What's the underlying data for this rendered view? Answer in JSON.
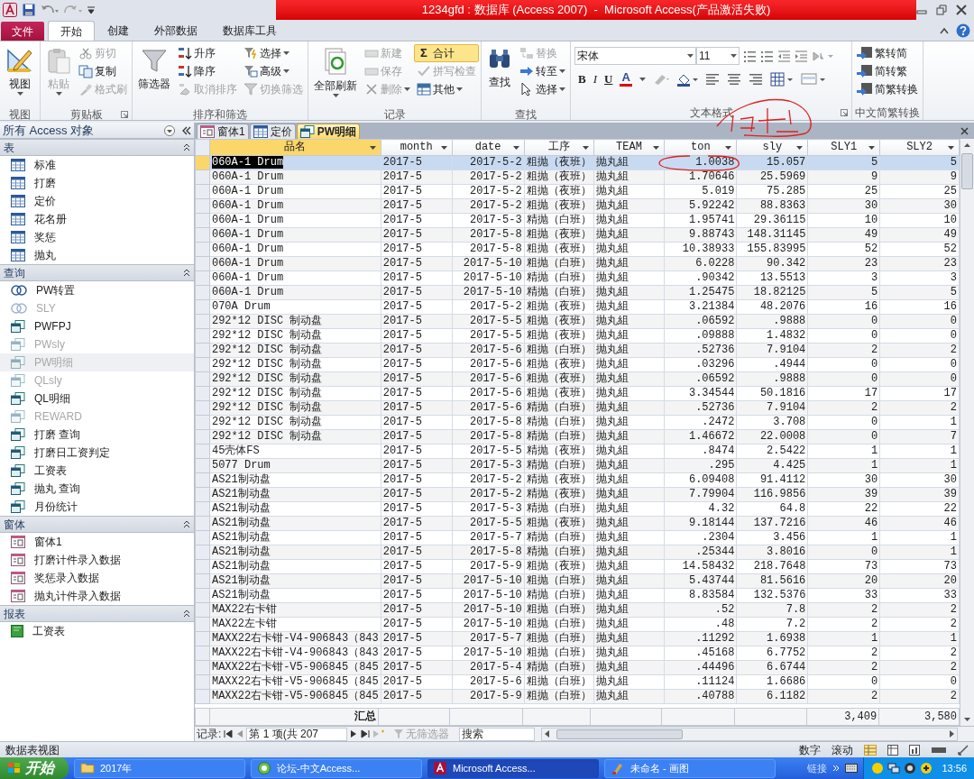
{
  "title_bar": {
    "title": "1234gfd : 数据库 (Access 2007)  -  Microsoft Access(产品激活失败)"
  },
  "ribbon_tabs": [
    {
      "label": "文件",
      "kind": "file",
      "selected": false
    },
    {
      "label": "开始",
      "kind": "tab",
      "selected": true
    },
    {
      "label": "创建",
      "kind": "tab",
      "selected": false
    },
    {
      "label": "外部数据",
      "kind": "tab",
      "selected": false
    },
    {
      "label": "数据库工具",
      "kind": "tab",
      "selected": false
    }
  ],
  "ribbon_groups": [
    {
      "label": "视图",
      "kind": "buttons",
      "launcher": false,
      "items": [
        {
          "label": "视图",
          "disabled": false,
          "dropdown": true,
          "pressed": false
        }
      ]
    },
    {
      "label": "剪贴板",
      "kind": "buttons",
      "launcher": true,
      "items": [
        {
          "label": "粘贴",
          "disabled": true,
          "dropdown": true,
          "pressed": false
        },
        {
          "label": "剪切",
          "disabled": true,
          "dropdown": false,
          "pressed": false
        },
        {
          "label": "复制",
          "disabled": false,
          "dropdown": false,
          "pressed": false
        },
        {
          "label": "格式刷",
          "disabled": true,
          "dropdown": false,
          "pressed": false
        }
      ]
    },
    {
      "label": "排序和筛选",
      "kind": "buttons",
      "launcher": false,
      "items": [
        {
          "label": "筛选器",
          "disabled": false,
          "dropdown": false,
          "pressed": false
        },
        {
          "label": "升序",
          "disabled": false,
          "dropdown": false,
          "pressed": false
        },
        {
          "label": "降序",
          "disabled": false,
          "dropdown": false,
          "pressed": false
        },
        {
          "label": "取消排序",
          "disabled": true,
          "dropdown": false,
          "pressed": false
        },
        {
          "label": "选择",
          "disabled": false,
          "dropdown": true,
          "pressed": false
        },
        {
          "label": "高级",
          "disabled": false,
          "dropdown": true,
          "pressed": false
        },
        {
          "label": "切换筛选",
          "disabled": true,
          "dropdown": false,
          "pressed": false
        }
      ]
    },
    {
      "label": "记录",
      "kind": "buttons",
      "launcher": false,
      "items": [
        {
          "label": "全部刷新",
          "disabled": false,
          "dropdown": true,
          "pressed": false
        },
        {
          "label": "新建",
          "disabled": true,
          "dropdown": false,
          "pressed": false
        },
        {
          "label": "保存",
          "disabled": true,
          "dropdown": false,
          "pressed": false
        },
        {
          "label": "删除",
          "disabled": true,
          "dropdown": true,
          "pressed": false
        },
        {
          "label": "合计",
          "symbol": "Σ",
          "disabled": false,
          "dropdown": false,
          "pressed": true
        },
        {
          "label": "拼写检查",
          "disabled": true,
          "dropdown": false,
          "pressed": false
        },
        {
          "label": "其他",
          "disabled": false,
          "dropdown": true,
          "pressed": false
        }
      ]
    },
    {
      "label": "查找",
      "kind": "buttons",
      "launcher": false,
      "items": [
        {
          "label": "查找",
          "disabled": false,
          "dropdown": false,
          "pressed": false
        },
        {
          "label": "替换",
          "disabled": true,
          "dropdown": false,
          "pressed": false
        },
        {
          "label": "转至",
          "disabled": false,
          "dropdown": true,
          "pressed": false
        },
        {
          "label": "选择",
          "disabled": false,
          "dropdown": true,
          "pressed": false
        }
      ]
    },
    {
      "label": "文本格式",
      "kind": "text_format",
      "launcher": true,
      "font": "宋体",
      "size": "11",
      "buttons": [
        "B",
        "I",
        "U",
        "A"
      ]
    },
    {
      "label": "中文简繁转换",
      "kind": "convert",
      "launcher": false,
      "items": [
        {
          "label": "繁转简",
          "disabled": false,
          "dropdown": false,
          "pressed": false
        },
        {
          "label": "简转繁",
          "disabled": false,
          "dropdown": false,
          "pressed": false
        },
        {
          "label": "简繁转换",
          "disabled": false,
          "dropdown": false,
          "pressed": false
        }
      ]
    }
  ],
  "nav_pane": {
    "title": "所有 Access 对象",
    "groups": [
      {
        "label": "表",
        "kind": "table",
        "items": [
          {
            "label": "标准",
            "dimmed": false,
            "selected": false
          },
          {
            "label": "打磨",
            "dimmed": false,
            "selected": false
          },
          {
            "label": "定价",
            "dimmed": false,
            "selected": false
          },
          {
            "label": "花名册",
            "dimmed": false,
            "selected": false
          },
          {
            "label": "奖惩",
            "dimmed": false,
            "selected": false
          },
          {
            "label": "抛丸",
            "dimmed": false,
            "selected": false
          }
        ]
      },
      {
        "label": "查询",
        "kind": "query",
        "items": [
          {
            "label": "PW转置",
            "kind": "crosstab",
            "dimmed": false,
            "selected": false
          },
          {
            "label": "SLY",
            "kind": "crosstab",
            "dimmed": true,
            "selected": false
          },
          {
            "label": "PWFPJ",
            "kind": "select",
            "dimmed": false,
            "selected": false
          },
          {
            "label": "PWsly",
            "kind": "select",
            "dimmed": true,
            "selected": false
          },
          {
            "label": "PW明细",
            "kind": "select",
            "dimmed": true,
            "selected": true
          },
          {
            "label": "QLsly",
            "kind": "select",
            "dimmed": true,
            "selected": false
          },
          {
            "label": "QL明细",
            "kind": "select",
            "dimmed": false,
            "selected": false
          },
          {
            "label": "REWARD",
            "kind": "select",
            "dimmed": true,
            "selected": false
          },
          {
            "label": "打磨 查询",
            "kind": "select",
            "dimmed": false,
            "selected": false
          },
          {
            "label": "打磨日工资判定",
            "kind": "select",
            "dimmed": false,
            "selected": false
          },
          {
            "label": "工资表",
            "kind": "select",
            "dimmed": false,
            "selected": false
          },
          {
            "label": "抛丸 查询",
            "kind": "select",
            "dimmed": false,
            "selected": false
          },
          {
            "label": "月份统计",
            "kind": "select",
            "dimmed": false,
            "selected": false
          }
        ]
      },
      {
        "label": "窗体",
        "kind": "form",
        "items": [
          {
            "label": "窗体1",
            "dimmed": false,
            "selected": false
          },
          {
            "label": "打磨计件录入数据",
            "dimmed": false,
            "selected": false
          },
          {
            "label": "奖惩录入数据",
            "dimmed": false,
            "selected": false
          },
          {
            "label": "抛丸计件录入数据",
            "dimmed": false,
            "selected": false
          }
        ]
      },
      {
        "label": "报表",
        "kind": "report",
        "items": [
          {
            "label": "工资表",
            "dimmed": false,
            "selected": false
          }
        ]
      }
    ]
  },
  "document_tabs": [
    {
      "label": "窗体1",
      "kind": "form",
      "selected": false
    },
    {
      "label": "定价",
      "kind": "table",
      "selected": false
    },
    {
      "label": "PW明细",
      "kind": "query",
      "selected": true
    }
  ],
  "datasheet": {
    "columns": [
      {
        "label": "品名",
        "selected": true
      },
      {
        "label": "month",
        "selected": false
      },
      {
        "label": "date",
        "selected": false
      },
      {
        "label": "工序",
        "selected": false
      },
      {
        "label": "TEAM",
        "selected": false
      },
      {
        "label": "ton",
        "selected": false
      },
      {
        "label": "sly",
        "selected": false
      },
      {
        "label": "SLY1",
        "selected": false
      },
      {
        "label": "SLY2",
        "selected": false
      }
    ],
    "rows": [
      {
        "selected": true,
        "cells": [
          "060A-1 Drum",
          "2017-5",
          "2017-5-2",
          "粗抛（夜班）",
          "抛丸組",
          "1.0038",
          "15.057",
          "5",
          "5"
        ]
      },
      {
        "selected": false,
        "cells": [
          "060A-1 Drum",
          "2017-5",
          "2017-5-2",
          "粗抛（夜班）",
          "抛丸組",
          "1.70646",
          "25.5969",
          "9",
          "9"
        ]
      },
      {
        "selected": false,
        "cells": [
          "060A-1 Drum",
          "2017-5",
          "2017-5-2",
          "粗抛（夜班）",
          "抛丸組",
          "5.019",
          "75.285",
          "25",
          "25"
        ]
      },
      {
        "selected": false,
        "cells": [
          "060A-1 Drum",
          "2017-5",
          "2017-5-2",
          "粗抛（夜班）",
          "抛丸組",
          "5.92242",
          "88.8363",
          "30",
          "30"
        ]
      },
      {
        "selected": false,
        "cells": [
          "060A-1 Drum",
          "2017-5",
          "2017-5-3",
          "精抛（白班）",
          "抛丸組",
          "1.95741",
          "29.36115",
          "10",
          "10"
        ]
      },
      {
        "selected": false,
        "cells": [
          "060A-1 Drum",
          "2017-5",
          "2017-5-8",
          "粗抛（夜班）",
          "抛丸組",
          "9.88743",
          "148.31145",
          "49",
          "49"
        ]
      },
      {
        "selected": false,
        "cells": [
          "060A-1 Drum",
          "2017-5",
          "2017-5-8",
          "粗抛（夜班）",
          "抛丸組",
          "10.38933",
          "155.83995",
          "52",
          "52"
        ]
      },
      {
        "selected": false,
        "cells": [
          "060A-1 Drum",
          "2017-5",
          "2017-5-10",
          "粗抛（白班）",
          "抛丸組",
          "6.0228",
          "90.342",
          "23",
          "23"
        ]
      },
      {
        "selected": false,
        "cells": [
          "060A-1 Drum",
          "2017-5",
          "2017-5-10",
          "精抛（白班）",
          "抛丸組",
          ".90342",
          "13.5513",
          "3",
          "3"
        ]
      },
      {
        "selected": false,
        "cells": [
          "060A-1 Drum",
          "2017-5",
          "2017-5-10",
          "精抛（白班）",
          "抛丸組",
          "1.25475",
          "18.82125",
          "5",
          "5"
        ]
      },
      {
        "selected": false,
        "cells": [
          "070A Drum",
          "2017-5",
          "2017-5-2",
          "粗抛（夜班）",
          "抛丸組",
          "3.21384",
          "48.2076",
          "16",
          "16"
        ]
      },
      {
        "selected": false,
        "cells": [
          "292*12 DISC 制动盘",
          "2017-5",
          "2017-5-5",
          "粗抛（夜班）",
          "抛丸組",
          ".06592",
          ".9888",
          "0",
          "0"
        ]
      },
      {
        "selected": false,
        "cells": [
          "292*12 DISC 制动盘",
          "2017-5",
          "2017-5-5",
          "粗抛（夜班）",
          "抛丸組",
          ".09888",
          "1.4832",
          "0",
          "0"
        ]
      },
      {
        "selected": false,
        "cells": [
          "292*12 DISC 制动盘",
          "2017-5",
          "2017-5-6",
          "粗抛（白班）",
          "抛丸組",
          ".52736",
          "7.9104",
          "2",
          "2"
        ]
      },
      {
        "selected": false,
        "cells": [
          "292*12 DISC 制动盘",
          "2017-5",
          "2017-5-6",
          "粗抛（夜班）",
          "抛丸組",
          ".03296",
          ".4944",
          "0",
          "0"
        ]
      },
      {
        "selected": false,
        "cells": [
          "292*12 DISC 制动盘",
          "2017-5",
          "2017-5-6",
          "粗抛（夜班）",
          "抛丸組",
          ".06592",
          ".9888",
          "0",
          "0"
        ]
      },
      {
        "selected": false,
        "cells": [
          "292*12 DISC 制动盘",
          "2017-5",
          "2017-5-6",
          "粗抛（夜班）",
          "抛丸組",
          "3.34544",
          "50.1816",
          "17",
          "17"
        ]
      },
      {
        "selected": false,
        "cells": [
          "292*12 DISC 制动盘",
          "2017-5",
          "2017-5-6",
          "精抛（白班）",
          "抛丸組",
          ".52736",
          "7.9104",
          "2",
          "2"
        ]
      },
      {
        "selected": false,
        "cells": [
          "292*12 DISC 制动盘",
          "2017-5",
          "2017-5-8",
          "精抛（白班）",
          "抛丸組",
          ".2472",
          "3.708",
          "0",
          "1"
        ]
      },
      {
        "selected": false,
        "cells": [
          "292*12 DISC 制动盘",
          "2017-5",
          "2017-5-8",
          "精抛（白班）",
          "抛丸組",
          "1.46672",
          "22.0008",
          "0",
          "7"
        ]
      },
      {
        "selected": false,
        "cells": [
          "45壳体FS",
          "2017-5",
          "2017-5-5",
          "精抛（夜班）",
          "抛丸組",
          ".8474",
          "2.5422",
          "1",
          "1"
        ]
      },
      {
        "selected": false,
        "cells": [
          "5077 Drum",
          "2017-5",
          "2017-5-3",
          "精抛（白班）",
          "抛丸組",
          ".295",
          "4.425",
          "1",
          "1"
        ]
      },
      {
        "selected": false,
        "cells": [
          "AS21制动盘",
          "2017-5",
          "2017-5-2",
          "精抛（夜班）",
          "抛丸組",
          "6.09408",
          "91.4112",
          "30",
          "30"
        ]
      },
      {
        "selected": false,
        "cells": [
          "AS21制动盘",
          "2017-5",
          "2017-5-2",
          "精抛（夜班）",
          "抛丸組",
          "7.79904",
          "116.9856",
          "39",
          "39"
        ]
      },
      {
        "selected": false,
        "cells": [
          "AS21制动盘",
          "2017-5",
          "2017-5-3",
          "精抛（白班）",
          "抛丸組",
          "4.32",
          "64.8",
          "22",
          "22"
        ]
      },
      {
        "selected": false,
        "cells": [
          "AS21制动盘",
          "2017-5",
          "2017-5-5",
          "粗抛（夜班）",
          "抛丸組",
          "9.18144",
          "137.7216",
          "46",
          "46"
        ]
      },
      {
        "selected": false,
        "cells": [
          "AS21制动盘",
          "2017-5",
          "2017-5-7",
          "精抛（白班）",
          "抛丸組",
          ".2304",
          "3.456",
          "1",
          "1"
        ]
      },
      {
        "selected": false,
        "cells": [
          "AS21制动盘",
          "2017-5",
          "2017-5-8",
          "精抛（白班）",
          "抛丸組",
          ".25344",
          "3.8016",
          "0",
          "1"
        ]
      },
      {
        "selected": false,
        "cells": [
          "AS21制动盘",
          "2017-5",
          "2017-5-9",
          "粗抛（夜班）",
          "抛丸組",
          "14.58432",
          "218.7648",
          "73",
          "73"
        ]
      },
      {
        "selected": false,
        "cells": [
          "AS21制动盘",
          "2017-5",
          "2017-5-10",
          "粗抛（白班）",
          "抛丸組",
          "5.43744",
          "81.5616",
          "20",
          "20"
        ]
      },
      {
        "selected": false,
        "cells": [
          "AS21制动盘",
          "2017-5",
          "2017-5-10",
          "精抛（白班）",
          "抛丸組",
          "8.83584",
          "132.5376",
          "33",
          "33"
        ]
      },
      {
        "selected": false,
        "cells": [
          "MAX22右卡钳",
          "2017-5",
          "2017-5-10",
          "粗抛（白班）",
          "抛丸組",
          ".52",
          "7.8",
          "2",
          "2"
        ]
      },
      {
        "selected": false,
        "cells": [
          "MAX22左卡钳",
          "2017-5",
          "2017-5-10",
          "粗抛（白班）",
          "抛丸組",
          ".48",
          "7.2",
          "2",
          "2"
        ]
      },
      {
        "selected": false,
        "cells": [
          "MAXX22右卡钳-V4-906843（843",
          "2017-5",
          "2017-5-7",
          "粗抛（白班）",
          "抛丸組",
          ".11292",
          "1.6938",
          "1",
          "1"
        ]
      },
      {
        "selected": false,
        "cells": [
          "MAXX22右卡钳-V4-906843（843",
          "2017-5",
          "2017-5-10",
          "粗抛（白班）",
          "抛丸組",
          ".45168",
          "6.7752",
          "2",
          "2"
        ]
      },
      {
        "selected": false,
        "cells": [
          "MAXX22右卡钳-V5-906845（845",
          "2017-5",
          "2017-5-4",
          "精抛（白班）",
          "抛丸組",
          ".44496",
          "6.6744",
          "2",
          "2"
        ]
      },
      {
        "selected": false,
        "cells": [
          "MAXX22右卡钳-V5-906845（845",
          "2017-5",
          "2017-5-6",
          "粗抛（白班）",
          "抛丸組",
          ".11124",
          "1.6686",
          "0",
          "0"
        ]
      },
      {
        "selected": false,
        "cells": [
          "MAXX22右卡钳-V5-906845（845",
          "2017-5",
          "2017-5-9",
          "粗抛（白班）",
          "抛丸組",
          ".40788",
          "6.1182",
          "2",
          "2"
        ]
      }
    ],
    "totals": {
      "label": "汇总",
      "sly1": "3,409",
      "sly2": "3,580"
    }
  },
  "record_nav": {
    "label": "记录:",
    "position": "第 1 项(共 207",
    "filter": "无筛选器",
    "search_placeholder": "搜索"
  },
  "status_bar": {
    "view": "数据表视图",
    "indicators": [
      "数字",
      "滚动"
    ]
  },
  "taskbar": {
    "start": "开始",
    "items": [
      {
        "label": "2017年",
        "kind": "folder",
        "selected": false
      },
      {
        "label": "论坛-中文Access...",
        "kind": "browser",
        "selected": false
      },
      {
        "label": "Microsoft Access...",
        "kind": "access",
        "selected": true
      },
      {
        "label": "未命名 - 画图",
        "kind": "paint",
        "selected": false
      }
    ],
    "links": "链接",
    "clock": "13:56"
  }
}
